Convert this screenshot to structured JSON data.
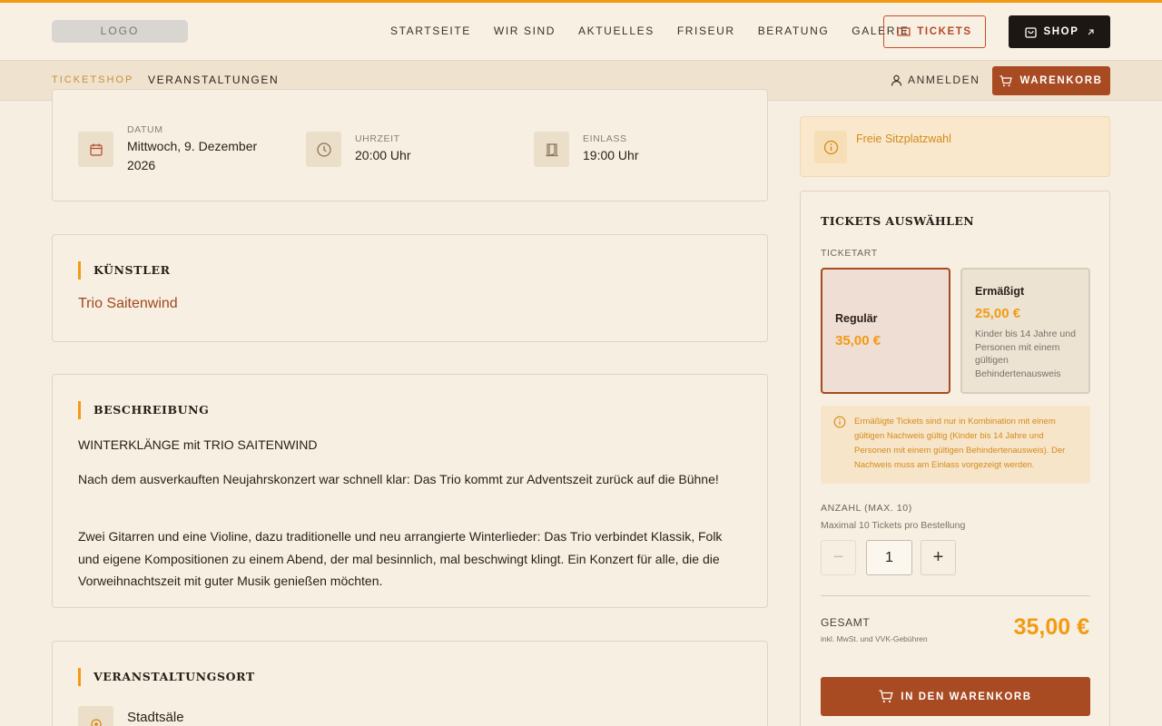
{
  "header": {
    "logo": "LOGO",
    "nav": [
      "STARTSEITE",
      "WIR SIND",
      "AKTUELLES",
      "FRISEUR",
      "BERATUNG",
      "GALERIE"
    ],
    "tickets_label": "TICKETS",
    "shop_label": "SHOP"
  },
  "subnav": {
    "ticketshop": "TICKETSHOP",
    "veranstaltungen": "VERANSTALTUNGEN",
    "login": "ANMELDEN",
    "cart": "WARENKORB"
  },
  "event": {
    "date_label": "DATUM",
    "date_value": "Mittwoch, 9. Dezember 2026",
    "time_label": "UHRZEIT",
    "time_value": "20:00 Uhr",
    "entry_label": "EINLASS",
    "entry_value": "19:00 Uhr"
  },
  "artist": {
    "heading": "KÜNSTLER",
    "name": "Trio Saitenwind"
  },
  "description": {
    "heading": "BESCHREIBUNG",
    "p1": "WINTERKLÄNGE mit TRIO SAITENWIND",
    "p2": "Nach dem ausverkauften Neujahrskonzert war schnell klar: Das Trio kommt zur Adventszeit zurück auf die Bühne!",
    "p3": "Zwei Gitarren und eine Violine, dazu traditionelle und neu arrangierte Winterlieder: Das Trio verbindet Klassik, Folk und eigene Kompositionen zu einem Abend, der mal besinnlich, mal beschwingt klingt. Ein Konzert für alle, die die Vorweihnachtszeit mit guter Musik genießen möchten."
  },
  "venue": {
    "heading": "VERANSTALTUNGSORT",
    "name": "Stadtsäle"
  },
  "sidebar": {
    "info": "Freie Sitzplatzwahl",
    "title": "TICKETS AUSWÄHLEN",
    "ticket_type_label": "TICKETART",
    "regular": {
      "name": "Regulär",
      "price": "35,00 €"
    },
    "reduced": {
      "name": "Ermäßigt",
      "price": "25,00 €",
      "desc": "Kinder bis 14 Jahre und Personen mit einem gültigen Behindertenausweis"
    },
    "warning": "Ermäßigte Tickets sind nur in Kombination mit einem gültigen Nachweis gültig (Kinder bis 14 Jahre und Personen mit einem gültigen Behindertenausweis). Der Nachweis muss am Einlass vorgezeigt werden.",
    "qty_label": "ANZAHL (MAX. 10)",
    "qty_hint": "Maximal 10 Tickets pro Bestellung",
    "qty_value": "1",
    "minus": "−",
    "plus": "+",
    "total_label": "GESAMT",
    "total_note": "inkl. MwSt. und VVK-Gebühren",
    "total_value": "35,00 €",
    "add_to_cart": "IN DEN WARENKORB"
  },
  "colors": {
    "accent": "#f39a12",
    "brand": "#a84a22",
    "background": "#f6eee1"
  }
}
